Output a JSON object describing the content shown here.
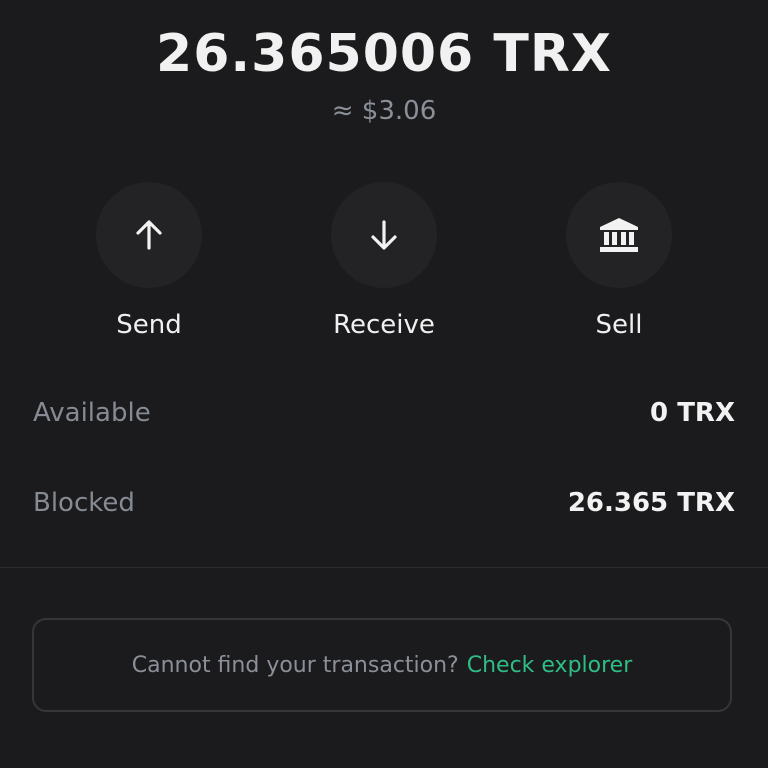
{
  "balance": {
    "amount": "26.365006 TRX",
    "fiat_estimate": "≈ $3.06"
  },
  "actions": {
    "send_label": "Send",
    "receive_label": "Receive",
    "sell_label": "Sell",
    "send_icon": "arrow-up-icon",
    "receive_icon": "arrow-down-icon",
    "sell_icon": "bank-icon"
  },
  "details": {
    "available_label": "Available",
    "available_value": "0 TRX",
    "blocked_label": "Blocked",
    "blocked_value": "26.365 TRX"
  },
  "notice": {
    "text": "Cannot find your transaction?",
    "link_text": "Check explorer"
  },
  "colors": {
    "background": "#1b1b1d",
    "button_circle": "#232325",
    "link_green": "#2ebd85",
    "muted_text": "#8a8f98"
  }
}
